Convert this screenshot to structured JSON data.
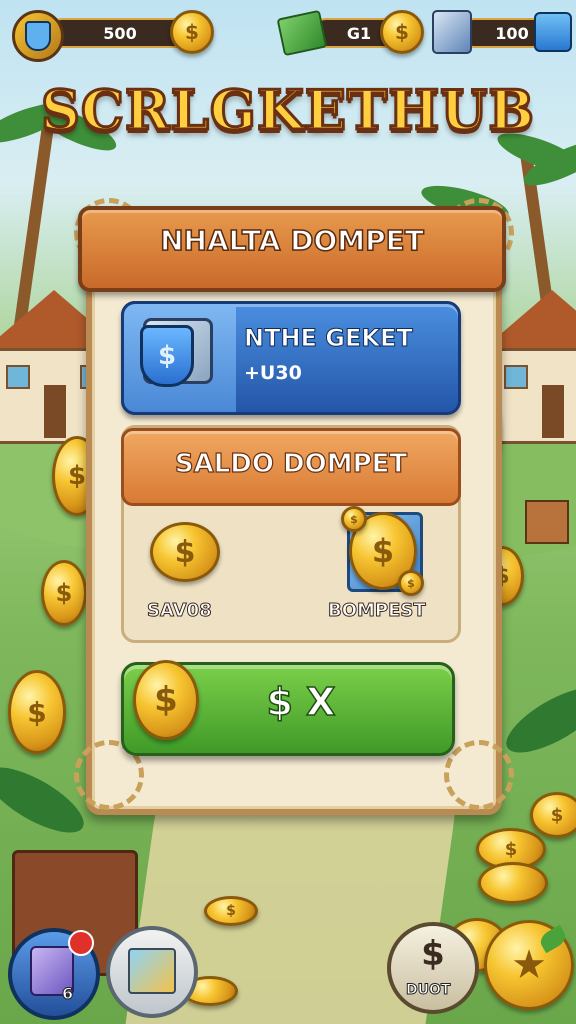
{
  "top_bar": {
    "resource_1": {
      "value": "500",
      "icon": "shield-wallet-icon"
    },
    "resource_2": {
      "value": "G1",
      "icon": "cash-stack-icon"
    },
    "resource_3": {
      "value": "100",
      "icon": "card-wallet-icon"
    }
  },
  "title": "SCRLGKETHUB",
  "panel": {
    "header": "NHALTA DOMPET",
    "ticket_button": {
      "title": "NTHE GEKET",
      "subtitle": "+U30"
    },
    "saldo_header": "SALDO DOMPET",
    "items": [
      {
        "label": "SAV08",
        "icon": "gold-coin-icon"
      },
      {
        "label": "BOMPEST",
        "icon": "coin-card-icon"
      }
    ],
    "action_button": {
      "label": "$ X"
    }
  },
  "bottom_bar": {
    "inventory_count": "6",
    "duot_label": "DUOT"
  },
  "colors": {
    "title_fill": "#ffcf3f",
    "header_orange": "#e08a40",
    "ticket_blue": "#2f6fc8",
    "action_green": "#5bb438",
    "panel_paper": "#f4ead2"
  }
}
